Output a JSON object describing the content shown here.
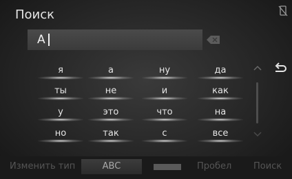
{
  "screen": {
    "title": "Поиск"
  },
  "search": {
    "value": "A"
  },
  "suggestions": [
    [
      "я",
      "а",
      "ну",
      "да"
    ],
    [
      "ты",
      "не",
      "и",
      "как"
    ],
    [
      "у",
      "это",
      "что",
      "на"
    ],
    [
      "но",
      "так",
      "с",
      "все"
    ]
  ],
  "bottom_bar": {
    "change_type": "Изменить тип",
    "abc": "ABC",
    "space": "Пробел",
    "search": "Поиск"
  },
  "icons": {
    "delete": "backspace-icon",
    "scroll_up": "chevron-up-icon",
    "scroll_down": "chevron-down-icon",
    "return": "return-arrow-icon",
    "corner": "no-phone-icon",
    "language": "keyboard-icon"
  },
  "colors": {
    "text": "#e6e6e6",
    "input_bg": "#4a4a4a",
    "dim": "#555555"
  }
}
